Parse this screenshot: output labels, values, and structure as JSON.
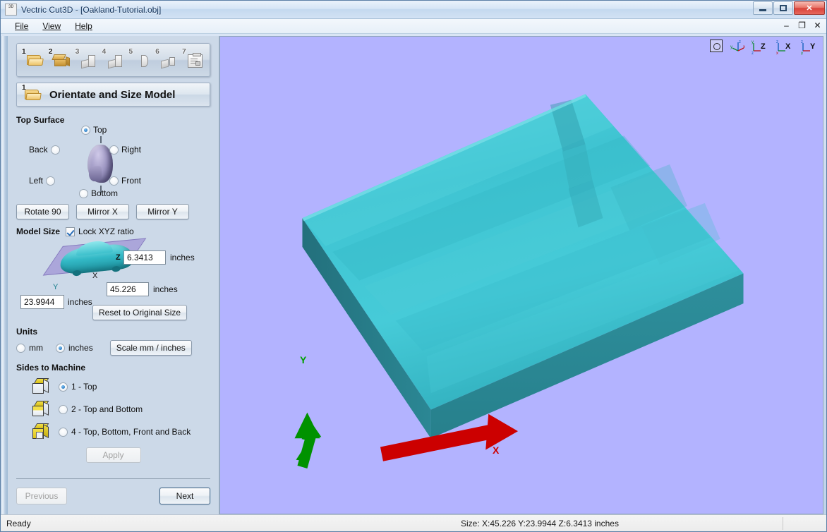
{
  "window": {
    "title": "Vectric Cut3D - [Oakland-Tutorial.obj]",
    "icon_name": "cut3d-app-icon",
    "icon_text": "3D",
    "buttons": {
      "minimize": "–",
      "maximize": "□",
      "close": "✕"
    }
  },
  "menubar": {
    "items": [
      {
        "label": "File",
        "accel": "F"
      },
      {
        "label": "View",
        "accel": "V"
      },
      {
        "label": "Help",
        "accel": "H"
      }
    ],
    "mdi": {
      "minimize": "–",
      "restore": "❐",
      "close": "✕"
    }
  },
  "sidebar": {
    "steps": [
      {
        "num": "1",
        "icon": "folder-open-icon",
        "name": "step-1-open-model"
      },
      {
        "num": "2",
        "icon": "box-icon",
        "name": "step-2-orientate"
      },
      {
        "num": "3",
        "icon": "slice-icon",
        "name": "step-3-toolpath"
      },
      {
        "num": "4",
        "icon": "layers-icon",
        "name": "step-4-preview"
      },
      {
        "num": "5",
        "icon": "shield-icon",
        "name": "step-5-simulate"
      },
      {
        "num": "6",
        "icon": "cut-icon",
        "name": "step-6-save"
      },
      {
        "num": "7",
        "icon": "document-icon",
        "name": "step-7-report"
      }
    ],
    "header": {
      "num": "1",
      "title": "Orientate and Size Model",
      "icon": "folder-open-icon"
    },
    "top_surface": {
      "label": "Top Surface",
      "options": [
        {
          "label": "Top",
          "selected": true
        },
        {
          "label": "Back",
          "selected": false
        },
        {
          "label": "Right",
          "selected": false
        },
        {
          "label": "Left",
          "selected": false
        },
        {
          "label": "Front",
          "selected": false
        },
        {
          "label": "Bottom",
          "selected": false
        }
      ]
    },
    "transform_buttons": [
      {
        "label": "Rotate 90"
      },
      {
        "label": "Mirror X"
      },
      {
        "label": "Mirror Y"
      }
    ],
    "model_size": {
      "label": "Model Size",
      "lock_label": "Lock XYZ ratio",
      "lock_checked": true,
      "z_value": "6.3413",
      "x_value": "45.226",
      "y_value": "23.9944",
      "unit_label": "inches",
      "axis_z": "Z",
      "axis_x": "X",
      "axis_y": "Y",
      "reset_label": "Reset to Original Size"
    },
    "units": {
      "label": "Units",
      "options": [
        {
          "label": "mm",
          "selected": false
        },
        {
          "label": "inches",
          "selected": true
        }
      ],
      "scale_button": "Scale mm / inches"
    },
    "sides": {
      "label": "Sides to Machine",
      "options": [
        {
          "label": "1 - Top",
          "selected": true,
          "icon": "cube-top-icon"
        },
        {
          "label": "2 - Top and Bottom",
          "selected": false,
          "icon": "cube-top-bottom-icon"
        },
        {
          "label": "4 - Top, Bottom, Front and Back",
          "selected": false,
          "icon": "cube-four-sides-icon"
        }
      ],
      "apply_label": "Apply",
      "apply_disabled": true
    },
    "nav": {
      "previous_label": "Previous",
      "previous_disabled": true,
      "next_label": "Next"
    }
  },
  "viewport": {
    "background_color": "#b3b3ff",
    "model_color": "#3fc8d8",
    "model_side_color": "#2a7f8c",
    "toolbar": [
      {
        "name": "zoom-to-fit-icon",
        "label": ""
      },
      {
        "name": "isometric-view-icon",
        "label": ""
      },
      {
        "name": "z-view-icon",
        "label": "Z"
      },
      {
        "name": "x-view-icon",
        "label": "X"
      },
      {
        "name": "y-view-icon",
        "label": "Y"
      }
    ],
    "axes": [
      {
        "name": "y-axis-arrow",
        "label": "Y",
        "color": "#00a000"
      },
      {
        "name": "x-axis-arrow",
        "label": "X",
        "color": "#cc0000"
      }
    ]
  },
  "statusbar": {
    "left": "Ready",
    "right": "Size: X:45.226 Y:23.9944 Z:6.3413 inches"
  }
}
